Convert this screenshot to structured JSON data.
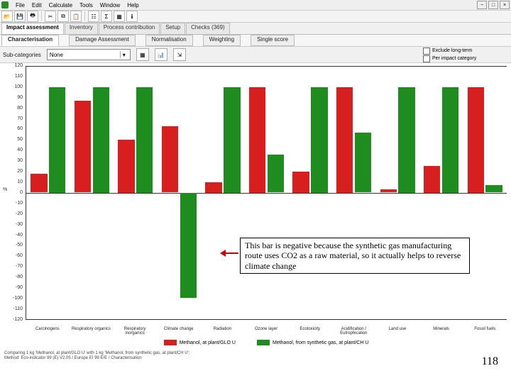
{
  "menu": {
    "items": [
      "File",
      "Edit",
      "Calculate",
      "Tools",
      "Window",
      "Help"
    ]
  },
  "toolbar": {
    "buttons": [
      "open",
      "save",
      "print",
      "cut",
      "copy",
      "paste",
      "tree",
      "calc",
      "chart",
      "info"
    ]
  },
  "tabs": {
    "items": [
      "Impact assessment",
      "Inventory",
      "Process contribution",
      "Setup",
      "Checks (369)"
    ],
    "active": 0
  },
  "subtabs": {
    "items": [
      "Characterisation",
      "Damage Assessment",
      "Normalisation",
      "Weighting",
      "Single score"
    ],
    "active": 0
  },
  "controls": {
    "label": "Sub-categories",
    "dropdown_value": "None",
    "checks": [
      "Exclude long-term",
      "Per impact category"
    ]
  },
  "chart_data": {
    "type": "bar",
    "ylabel": "%",
    "ylim": [
      -120,
      120
    ],
    "yticks": [
      120,
      110,
      100,
      90,
      80,
      70,
      60,
      50,
      40,
      30,
      20,
      10,
      0,
      -10,
      -20,
      -30,
      -40,
      -50,
      -60,
      -70,
      -80,
      -90,
      -100,
      -110,
      -120
    ],
    "categories": [
      "Carcinogens",
      "Respiratory organics",
      "Respiratory inorganics",
      "Climate change",
      "Radiation",
      "Ozone layer",
      "Ecotoxicity",
      "Acidification / Eutrophication",
      "Land use",
      "Minerals",
      "Fossil fuels"
    ],
    "series": [
      {
        "name": "Methanol, at plant/GLO U",
        "color": "#d81f1f",
        "values": [
          18,
          87,
          50,
          63,
          10,
          100,
          20,
          100,
          3,
          25,
          100
        ]
      },
      {
        "name": "Methanol, from synthetic gas, at plant/CH U",
        "color": "#1f8c1f",
        "values": [
          100,
          100,
          100,
          -100,
          100,
          36,
          100,
          57,
          100,
          100,
          7
        ]
      }
    ]
  },
  "legend": {
    "items": [
      "Methanol, at plant/GLO U",
      "Methanol, from synthetic gas, at plant/CH U"
    ]
  },
  "footer": {
    "line1": "Comparing 1 kg 'Methanol, at plant/GLO U' with 1 kg 'Methanol, from synthetic gas, at plant/CH U';",
    "line2": "Method: Eco-indicator 99 (E) V2.05 / Europe EI 99 E/E / Characterisation"
  },
  "callout": {
    "text": "This bar is negative because the synthetic gas manufacturing route uses CO2 as a raw material, so it actually helps to reverse climate change"
  },
  "page_number": "118"
}
